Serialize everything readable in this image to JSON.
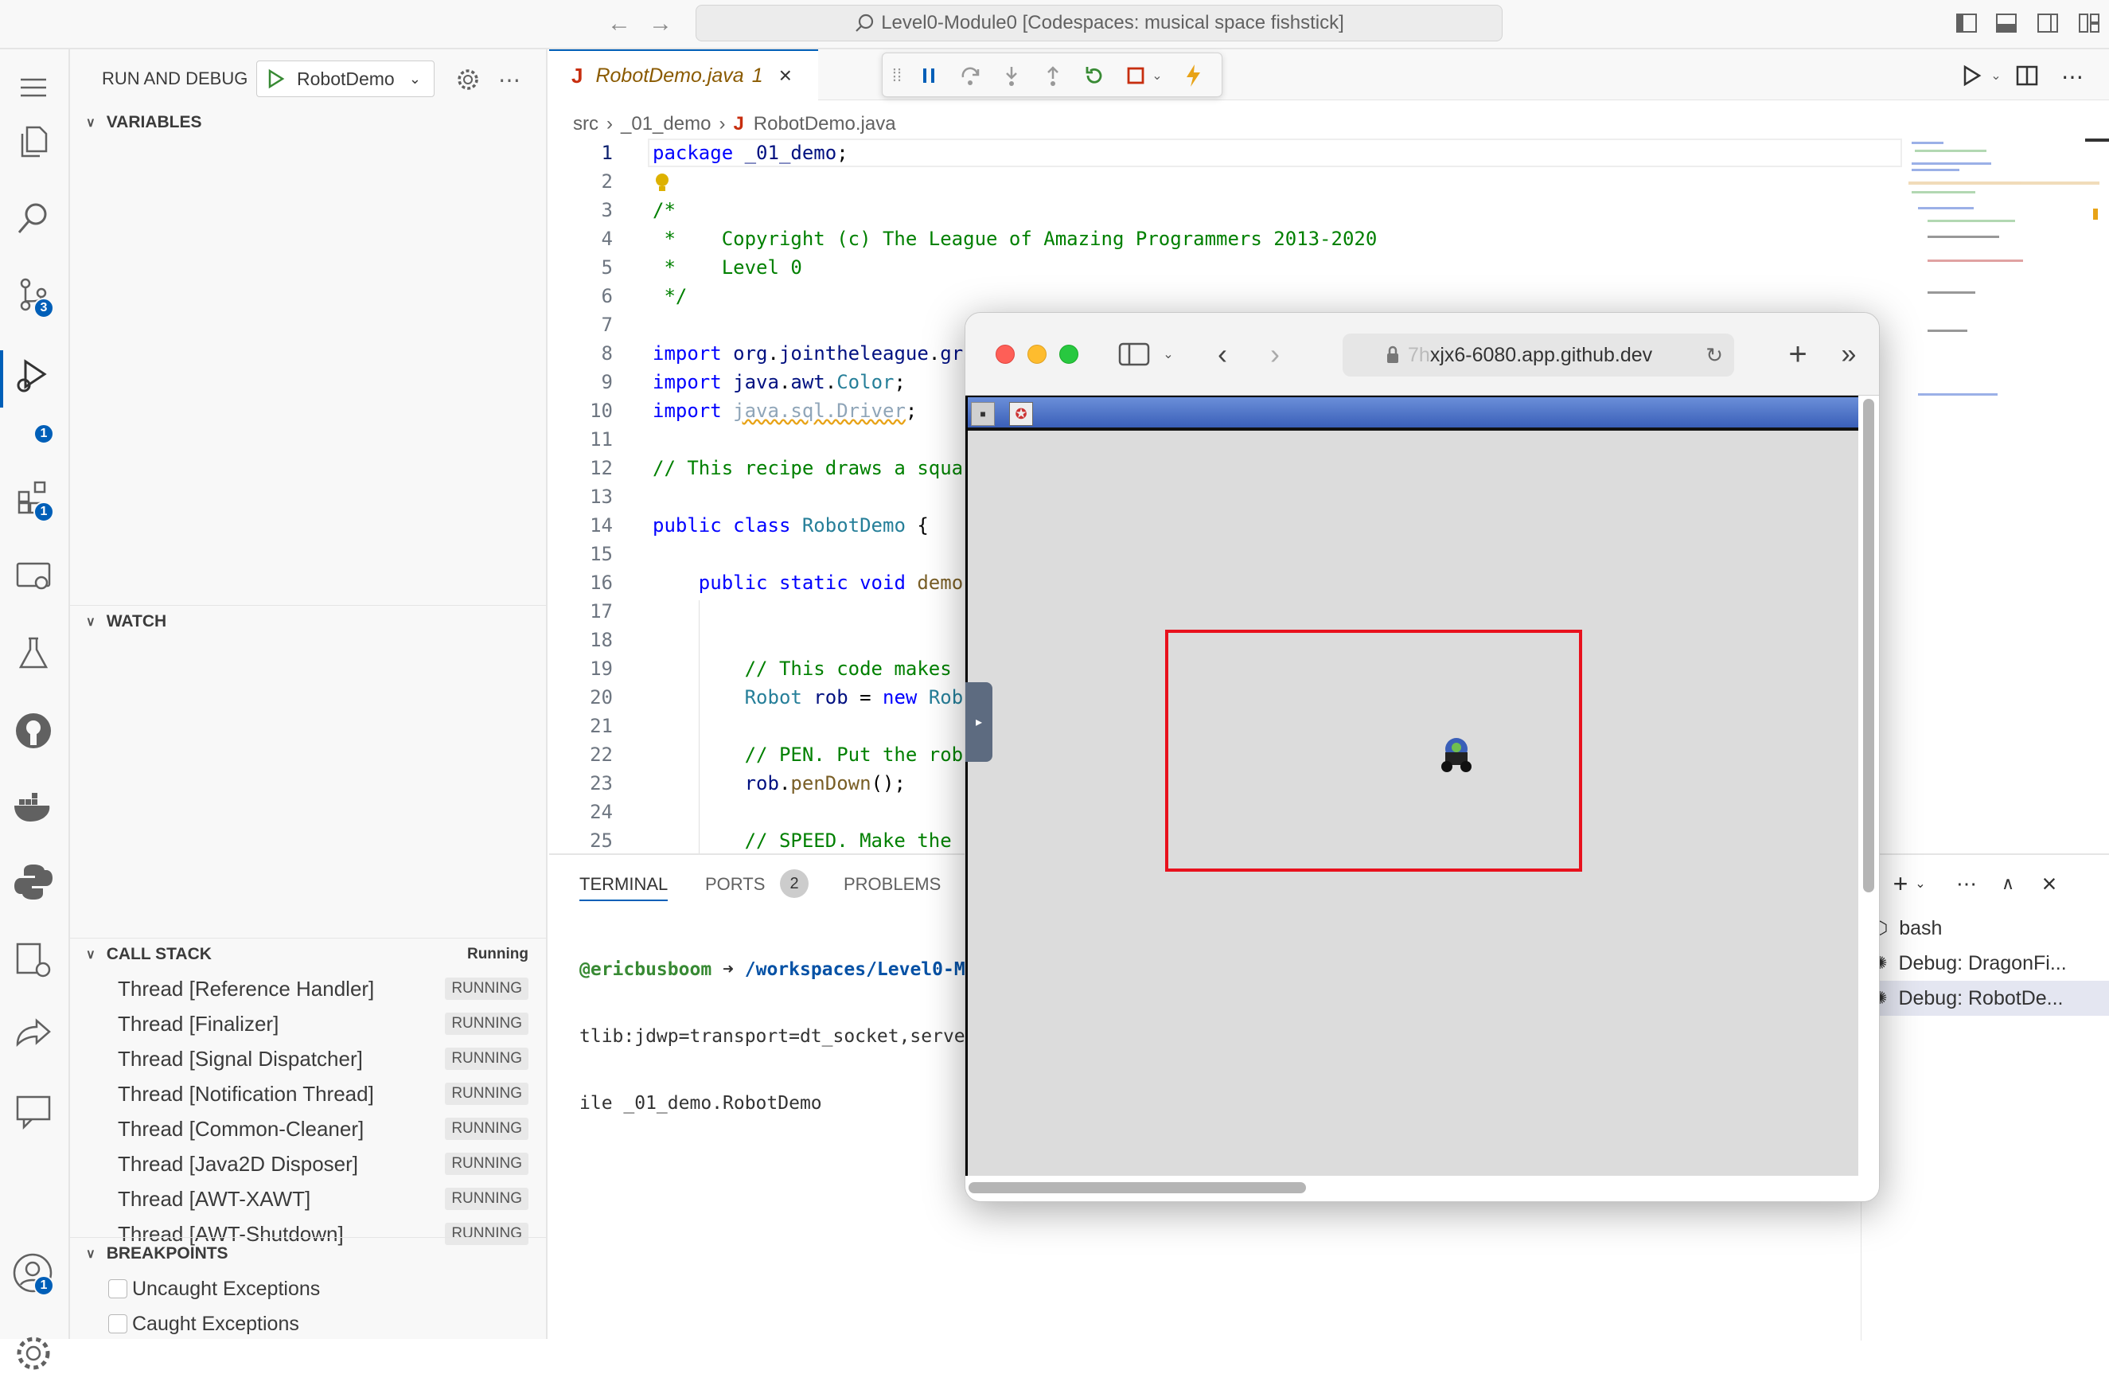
{
  "titlebar": {
    "search_text": "Level0-Module0 [Codespaces: musical space fishstick]"
  },
  "activity": {
    "badges": {
      "scm": "3",
      "debug": "1",
      "extensions": "1",
      "account": "1"
    }
  },
  "sidebar": {
    "title": "RUN AND DEBUG",
    "config": "RobotDemo",
    "variables": "VARIABLES",
    "watch": "WATCH",
    "callstack": {
      "title": "CALL STACK",
      "status": "Running",
      "threads": [
        {
          "name": "Thread [Reference Handler]",
          "state": "RUNNING"
        },
        {
          "name": "Thread [Finalizer]",
          "state": "RUNNING"
        },
        {
          "name": "Thread [Signal Dispatcher]",
          "state": "RUNNING"
        },
        {
          "name": "Thread [Notification Thread]",
          "state": "RUNNING"
        },
        {
          "name": "Thread [Common-Cleaner]",
          "state": "RUNNING"
        },
        {
          "name": "Thread [Java2D Disposer]",
          "state": "RUNNING"
        },
        {
          "name": "Thread [AWT-XAWT]",
          "state": "RUNNING"
        },
        {
          "name": "Thread [AWT-Shutdown]",
          "state": "RUNNING"
        }
      ]
    },
    "breakpoints": {
      "title": "BREAKPOINTS",
      "items": [
        "Uncaught Exceptions",
        "Caught Exceptions"
      ]
    }
  },
  "editor": {
    "tab_label": "RobotDemo.java",
    "tab_badge": "1",
    "breadcrumb": [
      "src",
      "_01_demo",
      "RobotDemo.java"
    ],
    "lines": [
      "1",
      "2",
      "3",
      "4",
      "5",
      "6",
      "7",
      "8",
      "9",
      "10",
      "11",
      "12",
      "13",
      "14",
      "15",
      "16",
      "17",
      "18",
      "19",
      "20",
      "21",
      "22",
      "23",
      "24",
      "25"
    ]
  },
  "panel": {
    "tabs": [
      "TERMINAL",
      "PORTS",
      "PROBLEMS"
    ],
    "ports_count": "2",
    "terminal": {
      "user": "@ericbusboom",
      "arrow": "➜",
      "path": "/workspaces/Level0-M",
      "line2": "tlib:jdwp=transport=dt_socket,serve",
      "line3": "ile _01_demo.RobotDemo"
    },
    "sessions": [
      "bash",
      "Debug: DragonFi...",
      "Debug: RobotDe..."
    ]
  },
  "browser": {
    "url_faded": "7h",
    "url_main": "xjx6-6080.app.github.dev"
  },
  "colors": {
    "accent": "#005fb8",
    "debug_green": "#388a34",
    "stop_red": "#c72e0f",
    "frame_red": "#e8111d",
    "java_red": "#c72e0f"
  }
}
